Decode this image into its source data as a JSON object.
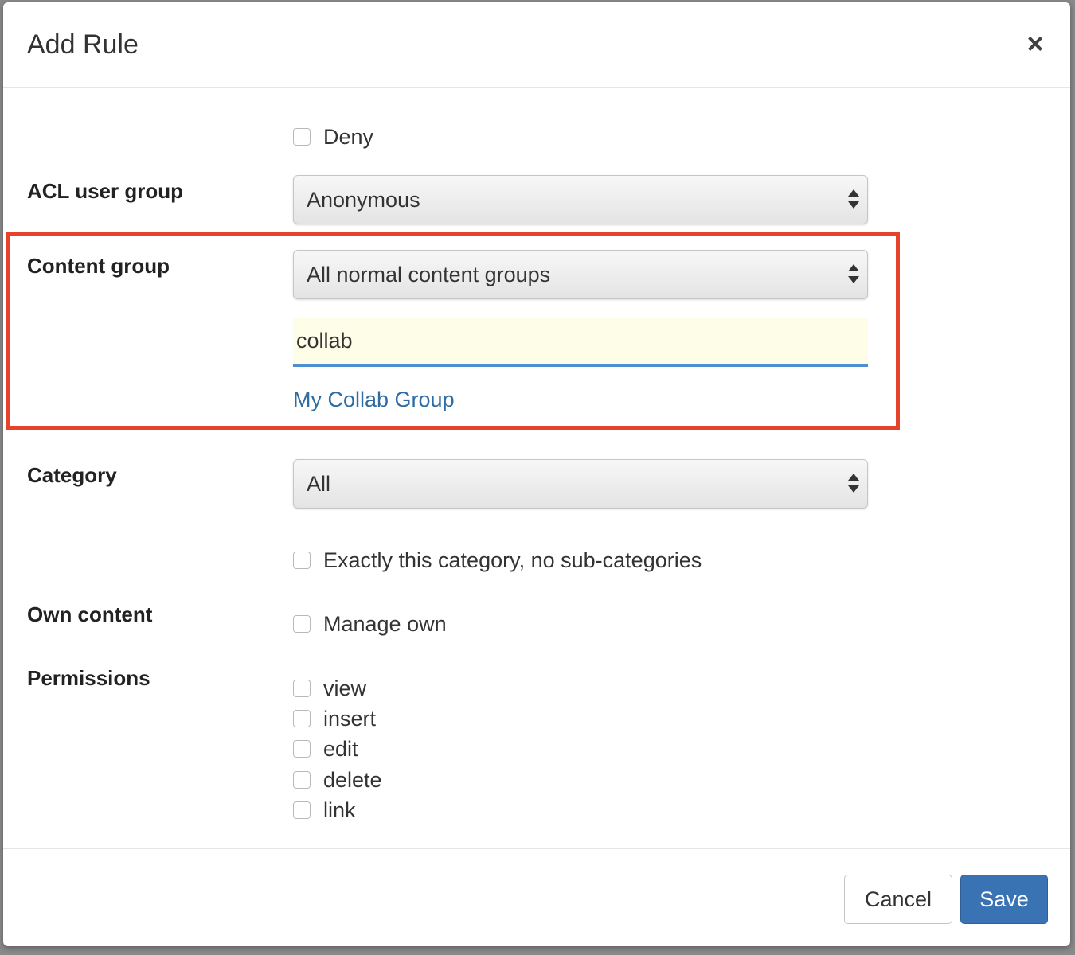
{
  "dialog": {
    "title": "Add Rule",
    "close_symbol": "×"
  },
  "deny": {
    "label": "Deny",
    "checked": false
  },
  "acl_user_group": {
    "label": "ACL user group",
    "selected": "Anonymous"
  },
  "content_group": {
    "label": "Content group",
    "selected": "All normal content groups",
    "search_value": "collab",
    "result": "My Collab Group"
  },
  "category": {
    "label": "Category",
    "selected": "All",
    "exact_label": "Exactly this category, no sub-categories"
  },
  "own_content": {
    "label": "Own content",
    "manage_own_label": "Manage own"
  },
  "permissions": {
    "label": "Permissions",
    "items": [
      "view",
      "insert",
      "edit",
      "delete",
      "link"
    ]
  },
  "footer": {
    "cancel_label": "Cancel",
    "save_label": "Save"
  },
  "colors": {
    "highlight": "#e5432a",
    "link": "#2e6da4",
    "primary": "#3a73b4",
    "input_focus": "#4f8fd1"
  },
  "icons": {
    "close": "close-icon",
    "select_arrows": "select-arrows-icon"
  }
}
